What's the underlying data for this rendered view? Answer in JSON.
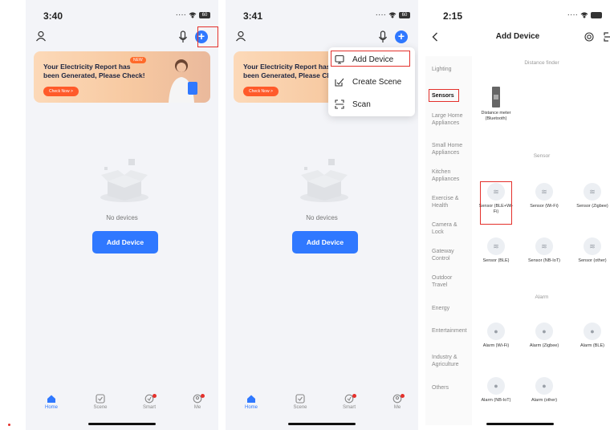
{
  "screens": [
    {
      "status_time": "3:40",
      "battery": "60",
      "banner": {
        "title": "Your Electricity Report has been Generated, Please Check!",
        "badge": "NEW",
        "button": "Check Now >"
      },
      "empty_text": "No devices",
      "add_device_label": "Add Device",
      "tabs": [
        "Home",
        "Scene",
        "Smart",
        "Me"
      ]
    },
    {
      "status_time": "3:41",
      "battery": "60",
      "banner": {
        "title": "Your Electricity Report has been Generated, Please Ch",
        "button": "Check Now >"
      },
      "empty_text": "No devices",
      "add_device_label": "Add Device",
      "menu": [
        "Add Device",
        "Create Scene",
        "Scan"
      ],
      "tabs": [
        "Home",
        "Scene",
        "Smart",
        "Me"
      ]
    },
    {
      "status_time": "2:15",
      "title": "Add Device",
      "categories": [
        "Lighting",
        "Sensors",
        "Large Home Appliances",
        "Small Home Appliances",
        "Kitchen Appliances",
        "Exercise & Health",
        "Camera & Lock",
        "Gateway Control",
        "Outdoor Travel",
        "Energy",
        "Entertainment",
        "Industry & Agriculture",
        "Others"
      ],
      "sections": {
        "distance": "Distance finder",
        "sensor": "Sensor",
        "alarm": "Alarm"
      },
      "distance_device": "Distance meter (Bluetooth)",
      "sensor_devices": [
        "Sensor (BLE+Wi-Fi)",
        "Sensor (Wi-Fi)",
        "Sensor (Zigbee)",
        "Sensor (BLE)",
        "Sensor (NB-IoT)",
        "Sensor (other)"
      ],
      "alarm_devices": [
        "Alarm (Wi-Fi)",
        "Alarm (Zigbee)",
        "Alarm (BLE)",
        "Alarm (NB-IoT)",
        "Alarm (other)"
      ]
    }
  ],
  "colors": {
    "accent": "#2f78ff",
    "highlight": "#e4302b"
  },
  "icons": [
    "user-icon",
    "mic-icon",
    "plus-icon",
    "home-icon",
    "scene-icon",
    "smart-icon",
    "me-icon",
    "back-icon",
    "scan-icon"
  ]
}
